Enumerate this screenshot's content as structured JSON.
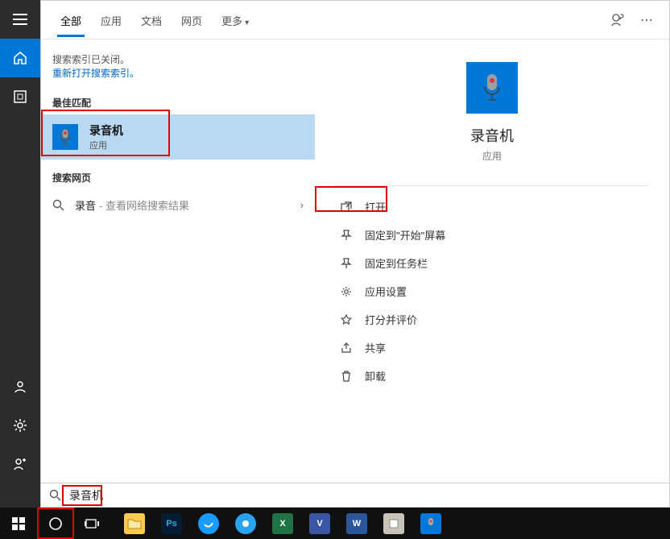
{
  "tabs": {
    "all": "全部",
    "apps": "应用",
    "docs": "文档",
    "web": "网页",
    "more": "更多"
  },
  "notice": {
    "line1": "搜索索引已关闭。",
    "link": "重新打开搜索索引。"
  },
  "sections": {
    "best": "最佳匹配",
    "web": "搜索网页"
  },
  "bestMatch": {
    "title": "录音机",
    "subtitle": "应用"
  },
  "webResult": {
    "term": "录音",
    "hint": "- 查看网络搜索结果"
  },
  "hero": {
    "title": "录音机",
    "subtitle": "应用"
  },
  "actions": {
    "open": "打开",
    "pinStart": "固定到\"开始\"屏幕",
    "pinTaskbar": "固定到任务栏",
    "settings": "应用设置",
    "rate": "打分并评价",
    "share": "共享",
    "uninstall": "卸载"
  },
  "search": {
    "value": "录音机"
  },
  "colors": {
    "accent": "#0178d7",
    "highlight": "#e00000"
  }
}
